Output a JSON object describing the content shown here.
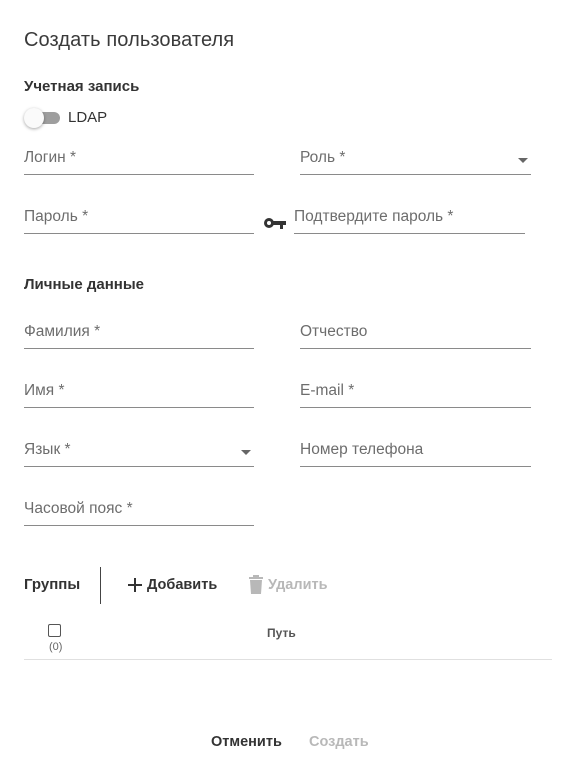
{
  "dialog": {
    "title": "Создать пользователя"
  },
  "account": {
    "section_title": "Учетная запись",
    "ldap_label": "LDAP",
    "ldap_enabled": false,
    "login_label": "Логин *",
    "role_label": "Роль *",
    "password_label": "Пароль *",
    "password_confirm_label": "Подтвердите пароль *",
    "password_icon": "key-icon"
  },
  "personal": {
    "section_title": "Личные данные",
    "last_name_label": "Фамилия *",
    "middle_name_label": "Отчество",
    "first_name_label": "Имя *",
    "email_label": "E-mail *",
    "language_label": "Язык *",
    "phone_label": "Номер телефона",
    "timezone_label": "Часовой пояс *"
  },
  "groups": {
    "section_title": "Группы",
    "add_label": "Добавить",
    "add_icon": "plus-icon",
    "delete_label": "Удалить",
    "delete_icon": "trash-icon",
    "table": {
      "selected_count": "(0)",
      "columns": [
        "Путь"
      ],
      "rows": []
    }
  },
  "actions": {
    "cancel_label": "Отменить",
    "create_label": "Создать"
  },
  "colors": {
    "text_primary": "#333333",
    "text_disabled": "#b8b8b8",
    "field_label": "#6d6d6d",
    "underline": "#8a8a8a"
  }
}
